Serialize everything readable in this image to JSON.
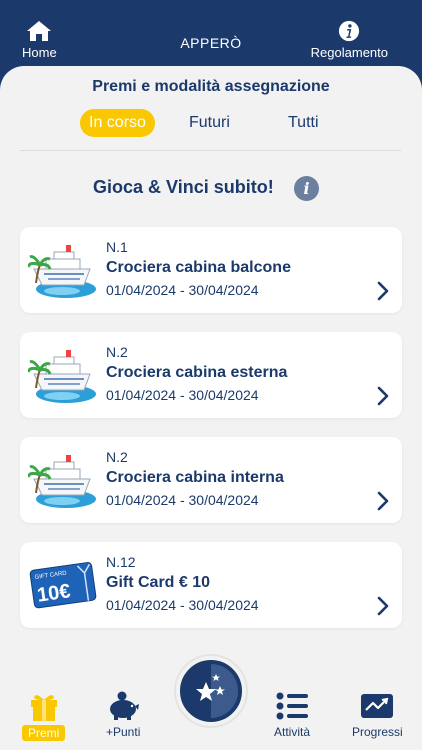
{
  "header": {
    "home_label": "Home",
    "title": "APPERÒ",
    "rules_label": "Regolamento"
  },
  "section": {
    "title": "Premi e modalità assegnazione"
  },
  "tabs": [
    {
      "label": "In corso",
      "active": true
    },
    {
      "label": "Futuri",
      "active": false
    },
    {
      "label": "Tutti",
      "active": false
    }
  ],
  "play": {
    "title": "Gioca & Vinci subito!"
  },
  "prizes": [
    {
      "qty": "N.1",
      "name": "Crociera cabina balcone",
      "dates": "01/04/2024 - 30/04/2024",
      "icon": "cruise-ship-icon"
    },
    {
      "qty": "N.2",
      "name": "Crociera cabina esterna",
      "dates": "01/04/2024 - 30/04/2024",
      "icon": "cruise-ship-icon"
    },
    {
      "qty": "N.2",
      "name": "Crociera cabina interna",
      "dates": "01/04/2024 - 30/04/2024",
      "icon": "cruise-ship-icon"
    },
    {
      "qty": "N.12",
      "name": "Gift Card € 10",
      "dates": "01/04/2024 - 30/04/2024",
      "icon": "gift-card-icon",
      "card_caption": "GIFT CARD",
      "card_value": "10€"
    }
  ],
  "bottom_nav": {
    "premi": "Premi",
    "punti": "+Punti",
    "attivita": "Attività",
    "progressi": "Progressi"
  },
  "colors": {
    "brand_navy": "#1b3a6b",
    "accent_yellow": "#f9c800",
    "background": "#f2f2f2"
  }
}
